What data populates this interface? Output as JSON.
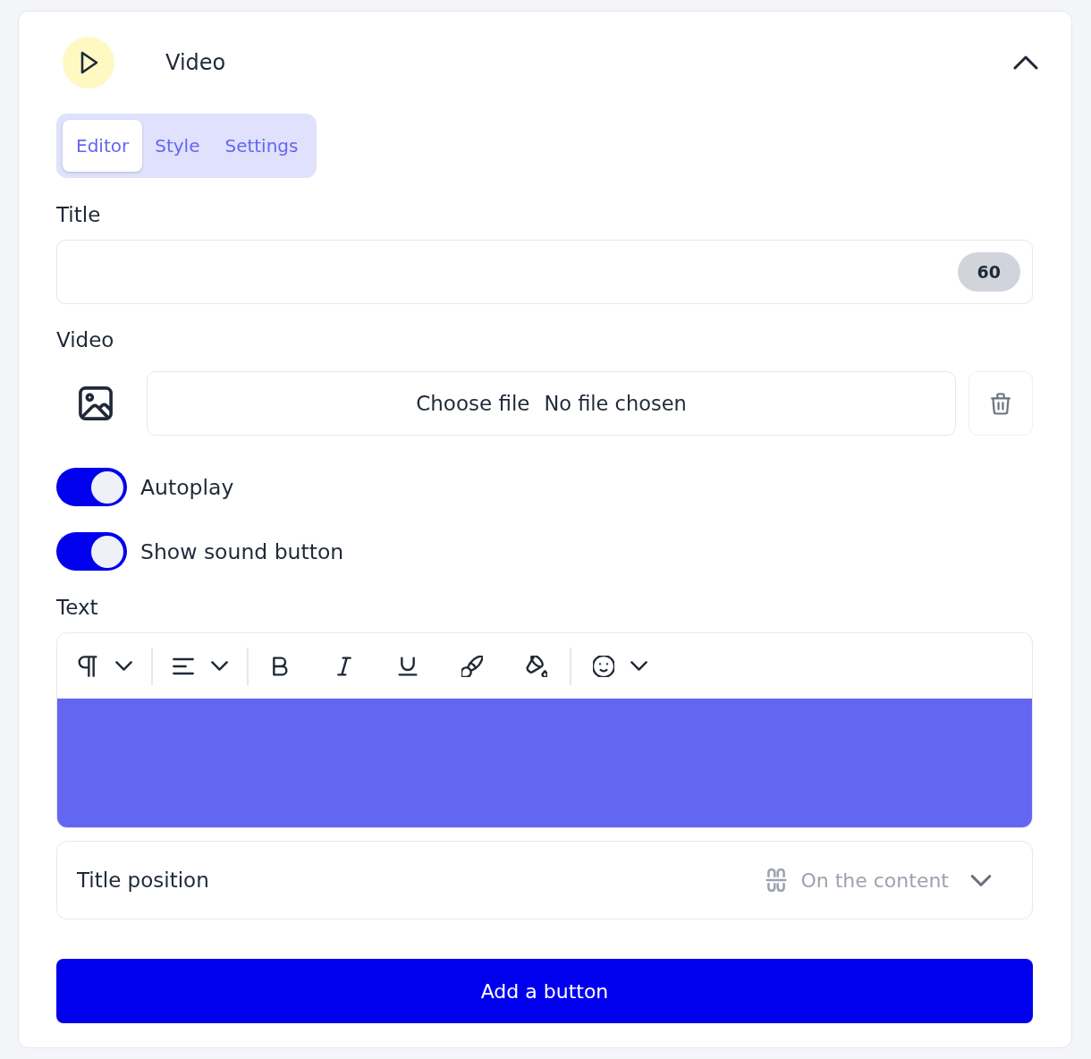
{
  "header": {
    "title": "Video",
    "expanded": true
  },
  "tabs": [
    {
      "label": "Editor",
      "selected": true
    },
    {
      "label": "Style",
      "selected": false
    },
    {
      "label": "Settings",
      "selected": false
    }
  ],
  "title_field": {
    "label": "Title",
    "counter": "60"
  },
  "video_field": {
    "label": "Video",
    "button": "Choose file",
    "status": "No file chosen"
  },
  "toggles": [
    {
      "label": "Autoplay",
      "on": true
    },
    {
      "label": "Show sound button",
      "on": true
    }
  ],
  "text_editor": {
    "label": "Text"
  },
  "title_position": {
    "label": "Title position",
    "value": "On the content"
  },
  "add_button": {
    "label": "Add a button"
  }
}
